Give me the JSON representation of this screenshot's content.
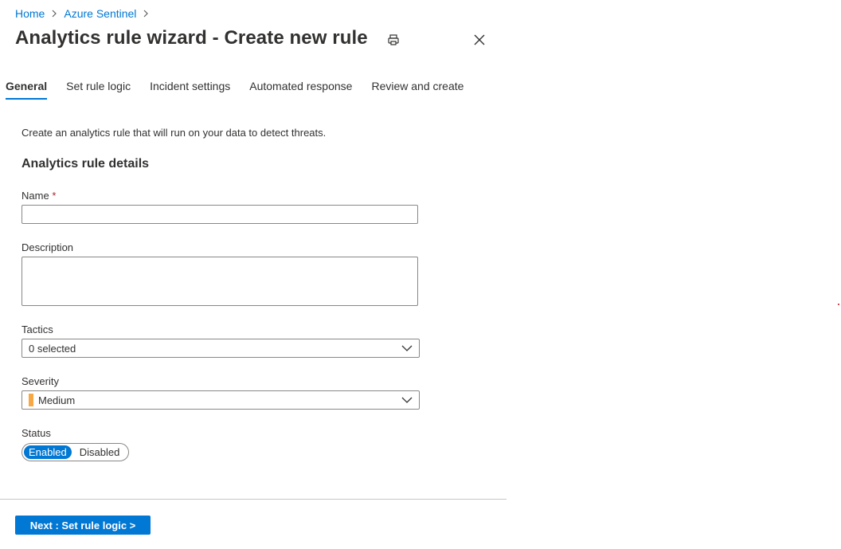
{
  "breadcrumb": {
    "items": [
      {
        "label": "Home"
      },
      {
        "label": "Azure Sentinel"
      }
    ]
  },
  "header": {
    "title": "Analytics rule wizard - Create new rule",
    "print_icon": "print-icon",
    "close_icon": "close-icon"
  },
  "tabs": [
    {
      "label": "General",
      "active": true
    },
    {
      "label": "Set rule logic",
      "active": false
    },
    {
      "label": "Incident settings",
      "active": false
    },
    {
      "label": "Automated response",
      "active": false
    },
    {
      "label": "Review and create",
      "active": false
    }
  ],
  "form": {
    "intro": "Create an analytics rule that will run on your data to detect threats.",
    "section_heading": "Analytics rule details",
    "name": {
      "label": "Name",
      "required_marker": "*",
      "value": ""
    },
    "description": {
      "label": "Description",
      "value": ""
    },
    "tactics": {
      "label": "Tactics",
      "value": "0 selected"
    },
    "severity": {
      "label": "Severity",
      "value": "Medium",
      "color": "#f7a844"
    },
    "status": {
      "label": "Status",
      "options": [
        "Enabled",
        "Disabled"
      ],
      "selected": "Enabled"
    }
  },
  "footer": {
    "next_label": "Next : Set rule logic >"
  },
  "colors": {
    "accent": "#0078d4",
    "required": "#a4262c",
    "severity_medium": "#f7a844"
  }
}
